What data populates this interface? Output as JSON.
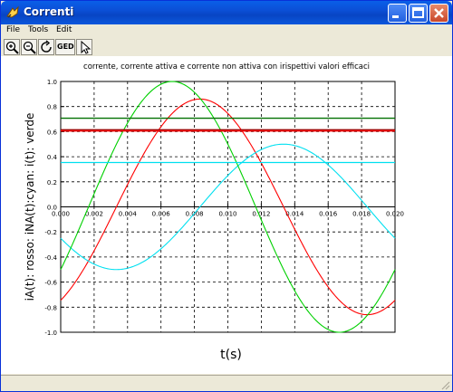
{
  "window": {
    "title": "Correnti"
  },
  "menu": [
    {
      "label": "File"
    },
    {
      "label": "Tools"
    },
    {
      "label": "Edit"
    }
  ],
  "toolbar": {
    "zoom_in": "zoom-in-icon",
    "zoom_out": "zoom-out-icon",
    "rotate": "rotate-icon",
    "geo_label": "GED",
    "pointer": "pointer-icon"
  },
  "chart_data": {
    "type": "line",
    "title": "corrente, corrente attiva e corrente non attiva con irispettivi valori efficaci",
    "xlabel": "t(s)",
    "ylabel": "iA(t): rosso: iNA(t):cyan: i(t): verde",
    "xlim": [
      0.0,
      0.02
    ],
    "ylim": [
      -1.0,
      1.0
    ],
    "xticks": [
      "0.000",
      "0.002",
      "0.004",
      "0.006",
      "0.008",
      "0.010",
      "0.012",
      "0.014",
      "0.016",
      "0.018",
      "0.020"
    ],
    "yticks": [
      "1.0",
      "0.8",
      "0.6",
      "0.4",
      "0.2",
      "0.0",
      "-0.2",
      "-0.4",
      "-0.6",
      "-0.8",
      "-1.0"
    ],
    "grid": true,
    "series": [
      {
        "color": "#ff0000",
        "kind": "sine",
        "amplitude": 0.86,
        "phase_deg": -60,
        "freq_hz": 50
      },
      {
        "color": "#00e0f0",
        "kind": "sine",
        "amplitude": 0.5,
        "phase_deg": -150,
        "freq_hz": 50
      },
      {
        "color": "#00d000",
        "kind": "sine",
        "amplitude": 1.0,
        "phase_deg": -30,
        "freq_hz": 50
      },
      {
        "color": "#007000",
        "kind": "constant",
        "value": 0.707
      },
      {
        "color": "#a00000",
        "kind": "constant",
        "value": 0.615
      },
      {
        "color": "#ff0000",
        "kind": "constant",
        "value": 0.605
      },
      {
        "color": "#00e0f0",
        "kind": "constant",
        "value": 0.354
      }
    ]
  }
}
